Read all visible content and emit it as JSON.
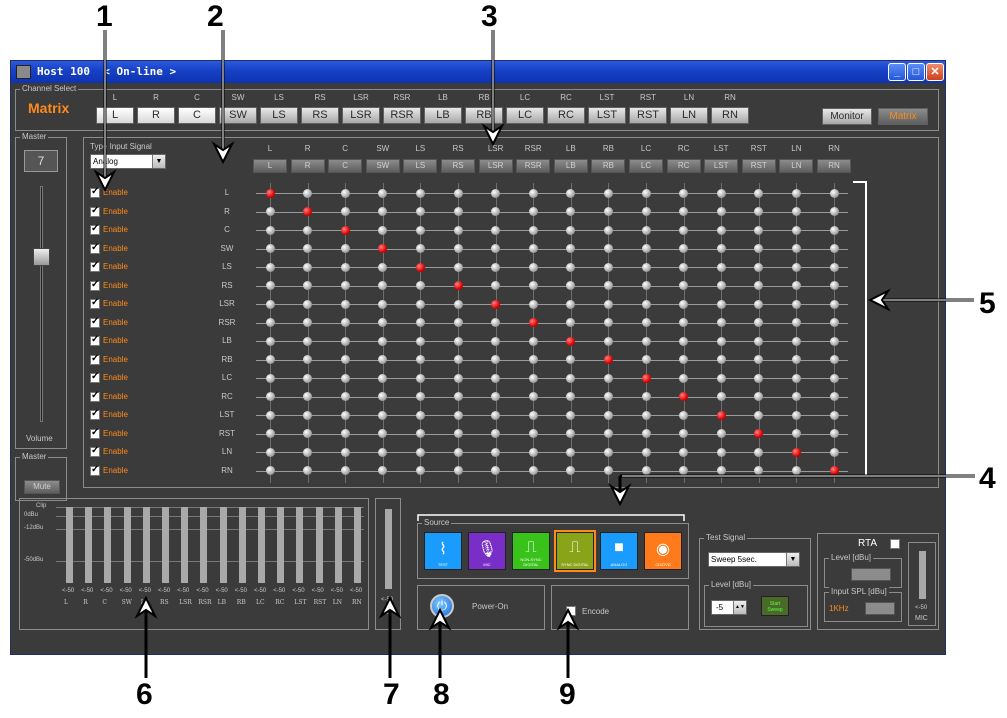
{
  "callouts": [
    "1",
    "2",
    "3",
    "4",
    "5",
    "6",
    "7",
    "8",
    "9"
  ],
  "window": {
    "title": "Host 100  < On-line >"
  },
  "channel_select": {
    "label": "Channel Select",
    "mode": "Matrix",
    "channels": [
      "L",
      "R",
      "C",
      "SW",
      "LS",
      "RS",
      "LSR",
      "RSR",
      "LB",
      "RB",
      "LC",
      "RC",
      "LST",
      "RST",
      "LN",
      "RN"
    ],
    "monitor_button": "Monitor",
    "matrix_button": "Matrix"
  },
  "master": {
    "label": "Master",
    "value": "7",
    "volume_label": "Volume"
  },
  "master_mute": {
    "label": "Master",
    "mute_button": "Mute"
  },
  "input_signal": {
    "label": "Type Input Signal",
    "value": "Analog"
  },
  "matrix": {
    "enable_label": "Enable",
    "rows": [
      "L",
      "R",
      "C",
      "SW",
      "LS",
      "RS",
      "LSR",
      "RSR",
      "LB",
      "RB",
      "LC",
      "RC",
      "LST",
      "RST",
      "LN",
      "RN"
    ],
    "cols": [
      "L",
      "R",
      "C",
      "SW",
      "LS",
      "RS",
      "LSR",
      "RSR",
      "LB",
      "RB",
      "LC",
      "RC",
      "LST",
      "RST",
      "LN",
      "RN"
    ]
  },
  "meters": {
    "scale": [
      "Clip",
      "0dBu",
      "-12dBu",
      "-50dBu"
    ],
    "readouts": [
      "<-50",
      "<-50",
      "<-50",
      "<-50",
      "<-50",
      "<-50",
      "<-50",
      "<-50",
      "<-50",
      "<-50",
      "<-50",
      "<-50",
      "<-50",
      "<-50",
      "<-50",
      "<-50"
    ],
    "labels": [
      "L",
      "R",
      "C",
      "SW",
      "LS",
      "RS",
      "LSR",
      "RSR",
      "LB",
      "RB",
      "LC",
      "RC",
      "LST",
      "RST",
      "LN",
      "RN"
    ]
  },
  "single_meter": {
    "readout": "<-50",
    "label": "L"
  },
  "source": {
    "label": "Source",
    "items": [
      {
        "label": "TEST",
        "color": "#1a9cff",
        "icon": "waveform-icon"
      },
      {
        "label": "MIC",
        "color": "#7a2ec8",
        "icon": "mic-icon"
      },
      {
        "label": "NON-SYNC DIGITAL",
        "color": "#38c21a",
        "icon": "digital-icon"
      },
      {
        "label": "SYNC DIGITAL",
        "color": "#8aa41a",
        "icon": "digital-icon"
      },
      {
        "label": "ANALOG",
        "color": "#1a9cff",
        "icon": "camera-icon"
      },
      {
        "label": "CD/DVD",
        "color": "#ff7a1a",
        "icon": "disc-icon"
      }
    ]
  },
  "power": {
    "label": "Power-On"
  },
  "encode": {
    "label": "Encode"
  },
  "test_signal": {
    "label": "Test Signal",
    "value": "Sweep 5sec.",
    "level_label": "Level [dBu]",
    "level_value": "-5",
    "start_button": "Start Sweep"
  },
  "rta": {
    "label": "RTA",
    "level_label": "Level [dBu]",
    "spl_label": "Input SPL [dBu]",
    "freq": "1KHz",
    "meter_readout": "<-50",
    "meter_label": "MIC"
  },
  "colors": {
    "active_node": "#e00000",
    "accent": "#ff8a1c",
    "titlebar": "#1842c7"
  }
}
